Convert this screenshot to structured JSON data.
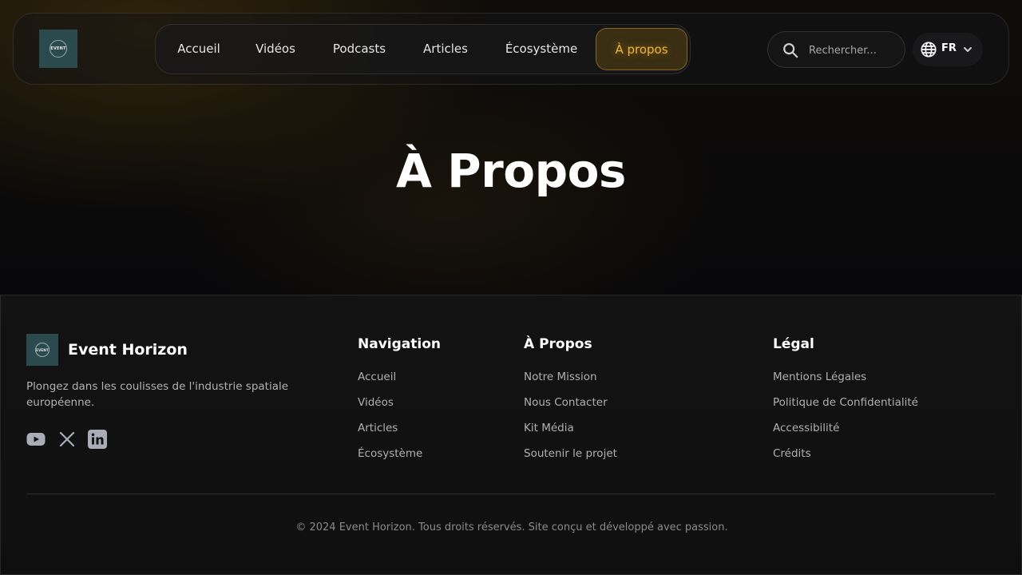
{
  "brand": {
    "logo_text": "EVENT",
    "name": "Event Horizon"
  },
  "nav": {
    "items": [
      {
        "label": "Accueil"
      },
      {
        "label": "Vidéos"
      },
      {
        "label": "Podcasts"
      },
      {
        "label": "Articles"
      },
      {
        "label": "Écosystème"
      },
      {
        "label": "À propos"
      }
    ],
    "active": "À propos"
  },
  "search": {
    "placeholder": "Rechercher..."
  },
  "language": {
    "code": "FR"
  },
  "hero": {
    "title": "À Propos"
  },
  "footer": {
    "tagline": "Plongez dans les coulisses de l'industrie spatiale européenne.",
    "social": [
      "youtube-icon",
      "x-icon",
      "linkedin-icon"
    ],
    "columns": [
      {
        "title": "Navigation",
        "links": [
          "Accueil",
          "Vidéos",
          "Articles",
          "Écosystème"
        ]
      },
      {
        "title": "À Propos",
        "links": [
          "Notre Mission",
          "Nous Contacter",
          "Kit Média",
          "Soutenir le projet"
        ]
      },
      {
        "title": "Légal",
        "links": [
          "Mentions Légales",
          "Politique de Confidentialité",
          "Accessibilité",
          "Crédits"
        ]
      }
    ],
    "copyright": "© 2024 Event Horizon. Tous droits réservés. Site conçu et développé avec passion."
  },
  "colors": {
    "accent": "#f2b632",
    "logo_bg": "#2a4a4e",
    "background": "#07080b"
  }
}
